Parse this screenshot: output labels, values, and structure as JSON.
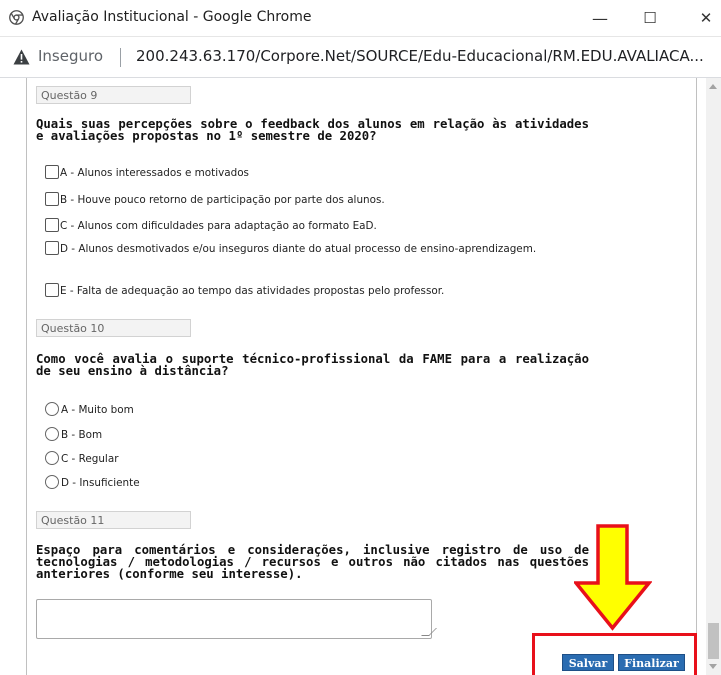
{
  "window": {
    "title": "Avaliação Institucional - Google Chrome",
    "minimize_glyph": "—",
    "maximize_glyph": "☐",
    "close_glyph": "✕"
  },
  "addressbar": {
    "security_label": "Inseguro",
    "url": "200.243.63.170/Corpore.Net/SOURCE/Edu-Educacional/RM.EDU.AVALIACA..."
  },
  "questions": [
    {
      "tag": "Questão 9",
      "text": "Quais suas percepções sobre o feedback dos alunos em relação às atividades e avaliações propostas no 1º semestre de 2020?",
      "options": [
        "A - Alunos interessados e motivados",
        "B - Houve pouco retorno de participação por parte dos alunos.",
        "C - Alunos com dificuldades para adaptação ao formato EaD.",
        "D - Alunos desmotivados e/ou inseguros diante do atual processo de ensino-aprendizagem.",
        "E - Falta de adequação ao tempo das atividades propostas pelo professor."
      ]
    },
    {
      "tag": "Questão 10",
      "text": "Como você avalia o suporte técnico-profissional da FAME para a realização de seu ensino à distância?",
      "options": [
        "A - Muito bom",
        "B - Bom",
        "C - Regular",
        "D - Insuficiente"
      ]
    },
    {
      "tag": "Questão 11",
      "text": "Espaço para comentários e considerações, inclusive registro de uso de tecnologias / metodologias / recursos e outros não citados nas questões anteriores (conforme seu interesse).",
      "answer_value": ""
    }
  ],
  "actions": {
    "save_label": "Salvar",
    "finish_label": "Finalizar"
  },
  "annotation": {
    "arrow_color": "#ffff00",
    "highlight_color": "#e8101a"
  },
  "colors": {
    "button_bg": "#2a6cb1"
  }
}
